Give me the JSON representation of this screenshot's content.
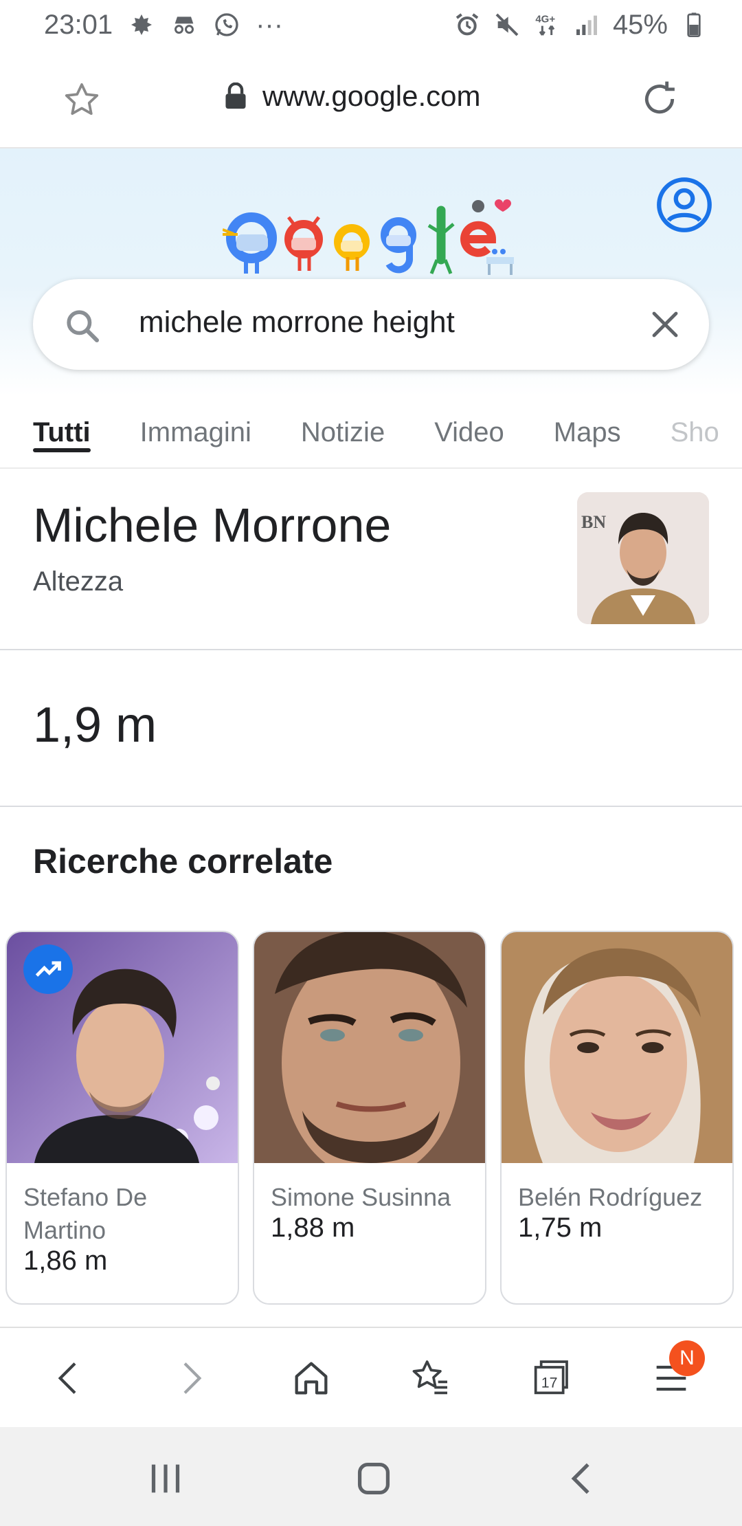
{
  "status_bar": {
    "time": "23:01",
    "more": "···",
    "battery": "45%",
    "network": "4G+"
  },
  "address_bar": {
    "url": "www.google.com"
  },
  "search": {
    "query": "michele morrone height"
  },
  "tabs": [
    {
      "label": "Tutti",
      "active": true
    },
    {
      "label": "Immagini",
      "active": false
    },
    {
      "label": "Notizie",
      "active": false
    },
    {
      "label": "Video",
      "active": false
    },
    {
      "label": "Maps",
      "active": false
    },
    {
      "label": "Sho",
      "active": false
    }
  ],
  "entity": {
    "name": "Michele Morrone",
    "attribute": "Altezza"
  },
  "answer": {
    "value": "1,9 m"
  },
  "related": {
    "title": "Ricerche correlate",
    "items": [
      {
        "name": "Stefano De Martino",
        "height": "1,86 m"
      },
      {
        "name": "Simone Susinna",
        "height": "1,88 m"
      },
      {
        "name": "Belén Rodríguez",
        "height": "1,75 m"
      }
    ]
  },
  "toolbar": {
    "tabs_count": "17",
    "menu_badge": "N"
  },
  "colors": {
    "accent_blue": "#1a73e8",
    "badge_orange": "#f4511e"
  }
}
